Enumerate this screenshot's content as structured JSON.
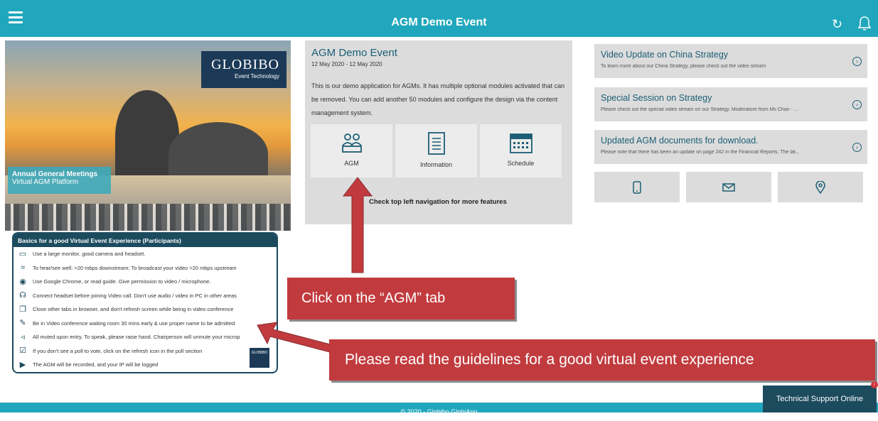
{
  "header": {
    "title": "AGM Demo Event"
  },
  "hero": {
    "logo_brand": "GLOBIBO",
    "logo_sub": "Event Technology",
    "band_line1": "Annual General Meetings",
    "band_line2": "Virtual AGM Platform"
  },
  "guidelines": {
    "title": "Basics for a good Virtual Event Experience (Participants)",
    "items": [
      {
        "icon": "monitor-icon",
        "text": "Use a large monitor, good camera and headset."
      },
      {
        "icon": "wifi-icon",
        "text": "To hear/see well: >20 mbps downstream; To broadcast your video >20 mbps upstream"
      },
      {
        "icon": "chrome-icon",
        "text": "Use Google Chrome, or read guide. Give permission to video / microphone."
      },
      {
        "icon": "headset-icon",
        "text": "Connect headset before joining Video call. Don't use audio / video in PC in other areas"
      },
      {
        "icon": "tabs-icon",
        "text": "Close other tabs in browser, and don't refresh screen while being in video conference"
      },
      {
        "icon": "edit-icon",
        "text": "Be in Video conference waiting room 30 mins early & use proper name to be admitted"
      },
      {
        "icon": "mute-icon",
        "text": "All muted upon entry. To speak, please raise hand. Chairperson will unmute your microp"
      },
      {
        "icon": "poll-icon",
        "text": "If you don't see a poll to vote, click on the refresh icon in the poll section"
      },
      {
        "icon": "camera-icon",
        "text": "The AGM will be recorded, and your IP will be logged"
      }
    ],
    "mini_logo": "GLOBIBO"
  },
  "event": {
    "title": "AGM Demo Event",
    "date": "12 May 2020 - 12 May 2020",
    "description": "This is our demo application for AGMs. It has multiple optional modules activated that can be removed. You can add another 50 modules and configure the design via the content management system.",
    "tiles": [
      {
        "label": "AGM",
        "icon": "people-icon"
      },
      {
        "label": "Information",
        "icon": "document-icon"
      },
      {
        "label": "Schedule",
        "icon": "calendar-icon"
      }
    ],
    "hint": "Check top left navigation for more features"
  },
  "news": [
    {
      "title": "Video Update on China Strategy",
      "desc": "To learn more about our China Strategy, please check out the video stream"
    },
    {
      "title": "Special Session on Strategy",
      "desc": "Please check out the special video stream on our Strategy. Moderatore from Ms Chan - ..."
    },
    {
      "title": "Updated AGM documents for download.",
      "desc": "Please note that there has been an update on page 242 in the Financial Reports. The lat..."
    }
  ],
  "actions": [
    "phone-icon",
    "mail-icon",
    "location-icon"
  ],
  "callouts": {
    "agm_tab": "Click on the “AGM” tab",
    "guidelines": "Please read the guidelines for a good virtual event experience"
  },
  "footer": {
    "text": "© 2020 - Globibo GlobiApp"
  },
  "support": {
    "label": "Technical Support Online",
    "badge": "i"
  }
}
